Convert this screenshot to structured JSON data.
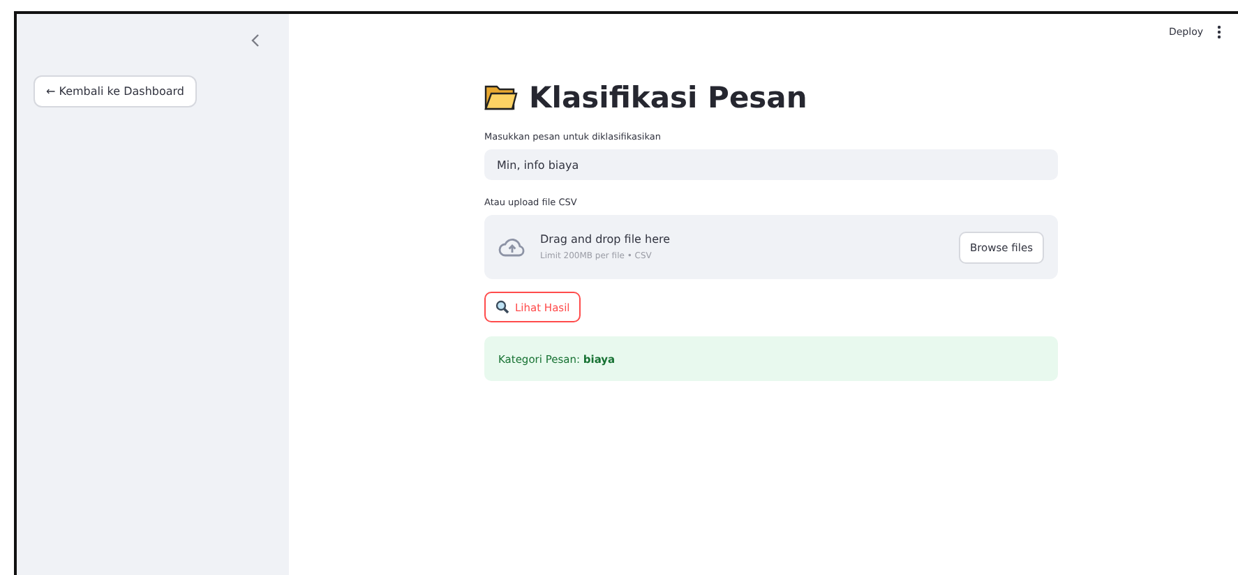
{
  "sidebar": {
    "back_button": "← Kembali ke Dashboard"
  },
  "header": {
    "deploy": "Deploy"
  },
  "title": "Klasifikasi Pesan",
  "message_input": {
    "label": "Masukkan pesan untuk diklasifikasikan",
    "value": "Min, info biaya"
  },
  "uploader": {
    "label": "Atau upload file CSV",
    "title": "Drag and drop file here",
    "hint": "Limit 200MB per file • CSV",
    "button": "Browse files"
  },
  "submit_button": "Lihat Hasil",
  "result": "Kategori Pesan: **biaya**"
}
